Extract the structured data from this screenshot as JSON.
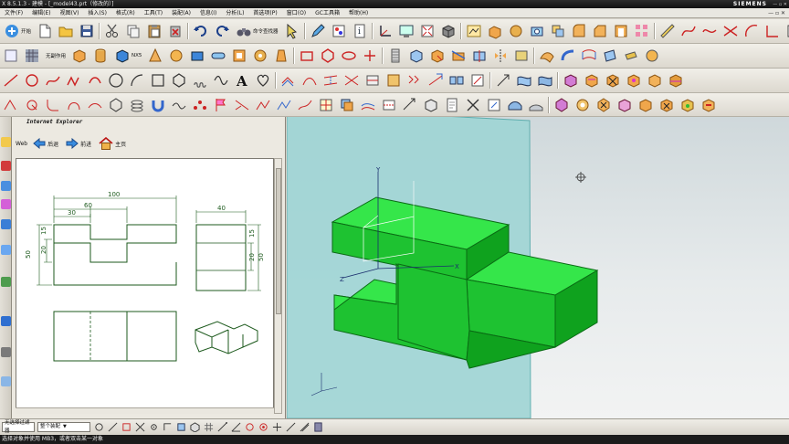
{
  "window": {
    "title": "X 8.5.1.3 - 建模 - [_model43.prt（修改的）]",
    "brand": "SIEMENS",
    "controls": "— ▫ ✕"
  },
  "menubar": {
    "items": [
      "文件(F)",
      "编辑(E)",
      "视图(V)",
      "插入(S)",
      "格式(R)",
      "工具(T)",
      "装配(A)",
      "信息(I)",
      "分析(L)",
      "首选项(P)",
      "窗口(O)",
      "GC工具箱",
      "帮助(H)"
    ],
    "mdi_controls": "— ▫ ✕"
  },
  "toolbar": {
    "start_label": "开始",
    "command_finder_label": "命令查找器",
    "nx5_label": "NX5",
    "sync_label": "无副作用"
  },
  "ie_panel": {
    "title": "Internet Explorer",
    "web_label": "Web",
    "back_label": "后退",
    "forward_label": "前进",
    "home_label": "主页"
  },
  "drawing": {
    "dims": {
      "overall_width": "100",
      "middle_width": "60",
      "left_part": "30",
      "side_width": "40",
      "height_total": "50",
      "height_upper": "15",
      "height_mid": "20",
      "right_height_upper": "15",
      "right_height_mid": "20",
      "right_height_total": "50"
    }
  },
  "bottom": {
    "filter_combo": "无选择过滤器",
    "scope_combo": "整个装配",
    "status": "选择对象并使用 MB3，或者双击某一对象"
  },
  "colors": {
    "part_face": "#35e64a",
    "part_dark": "#0fa21e",
    "plane": "#9fd5d5",
    "drawing_line": "#1d5a1d"
  }
}
